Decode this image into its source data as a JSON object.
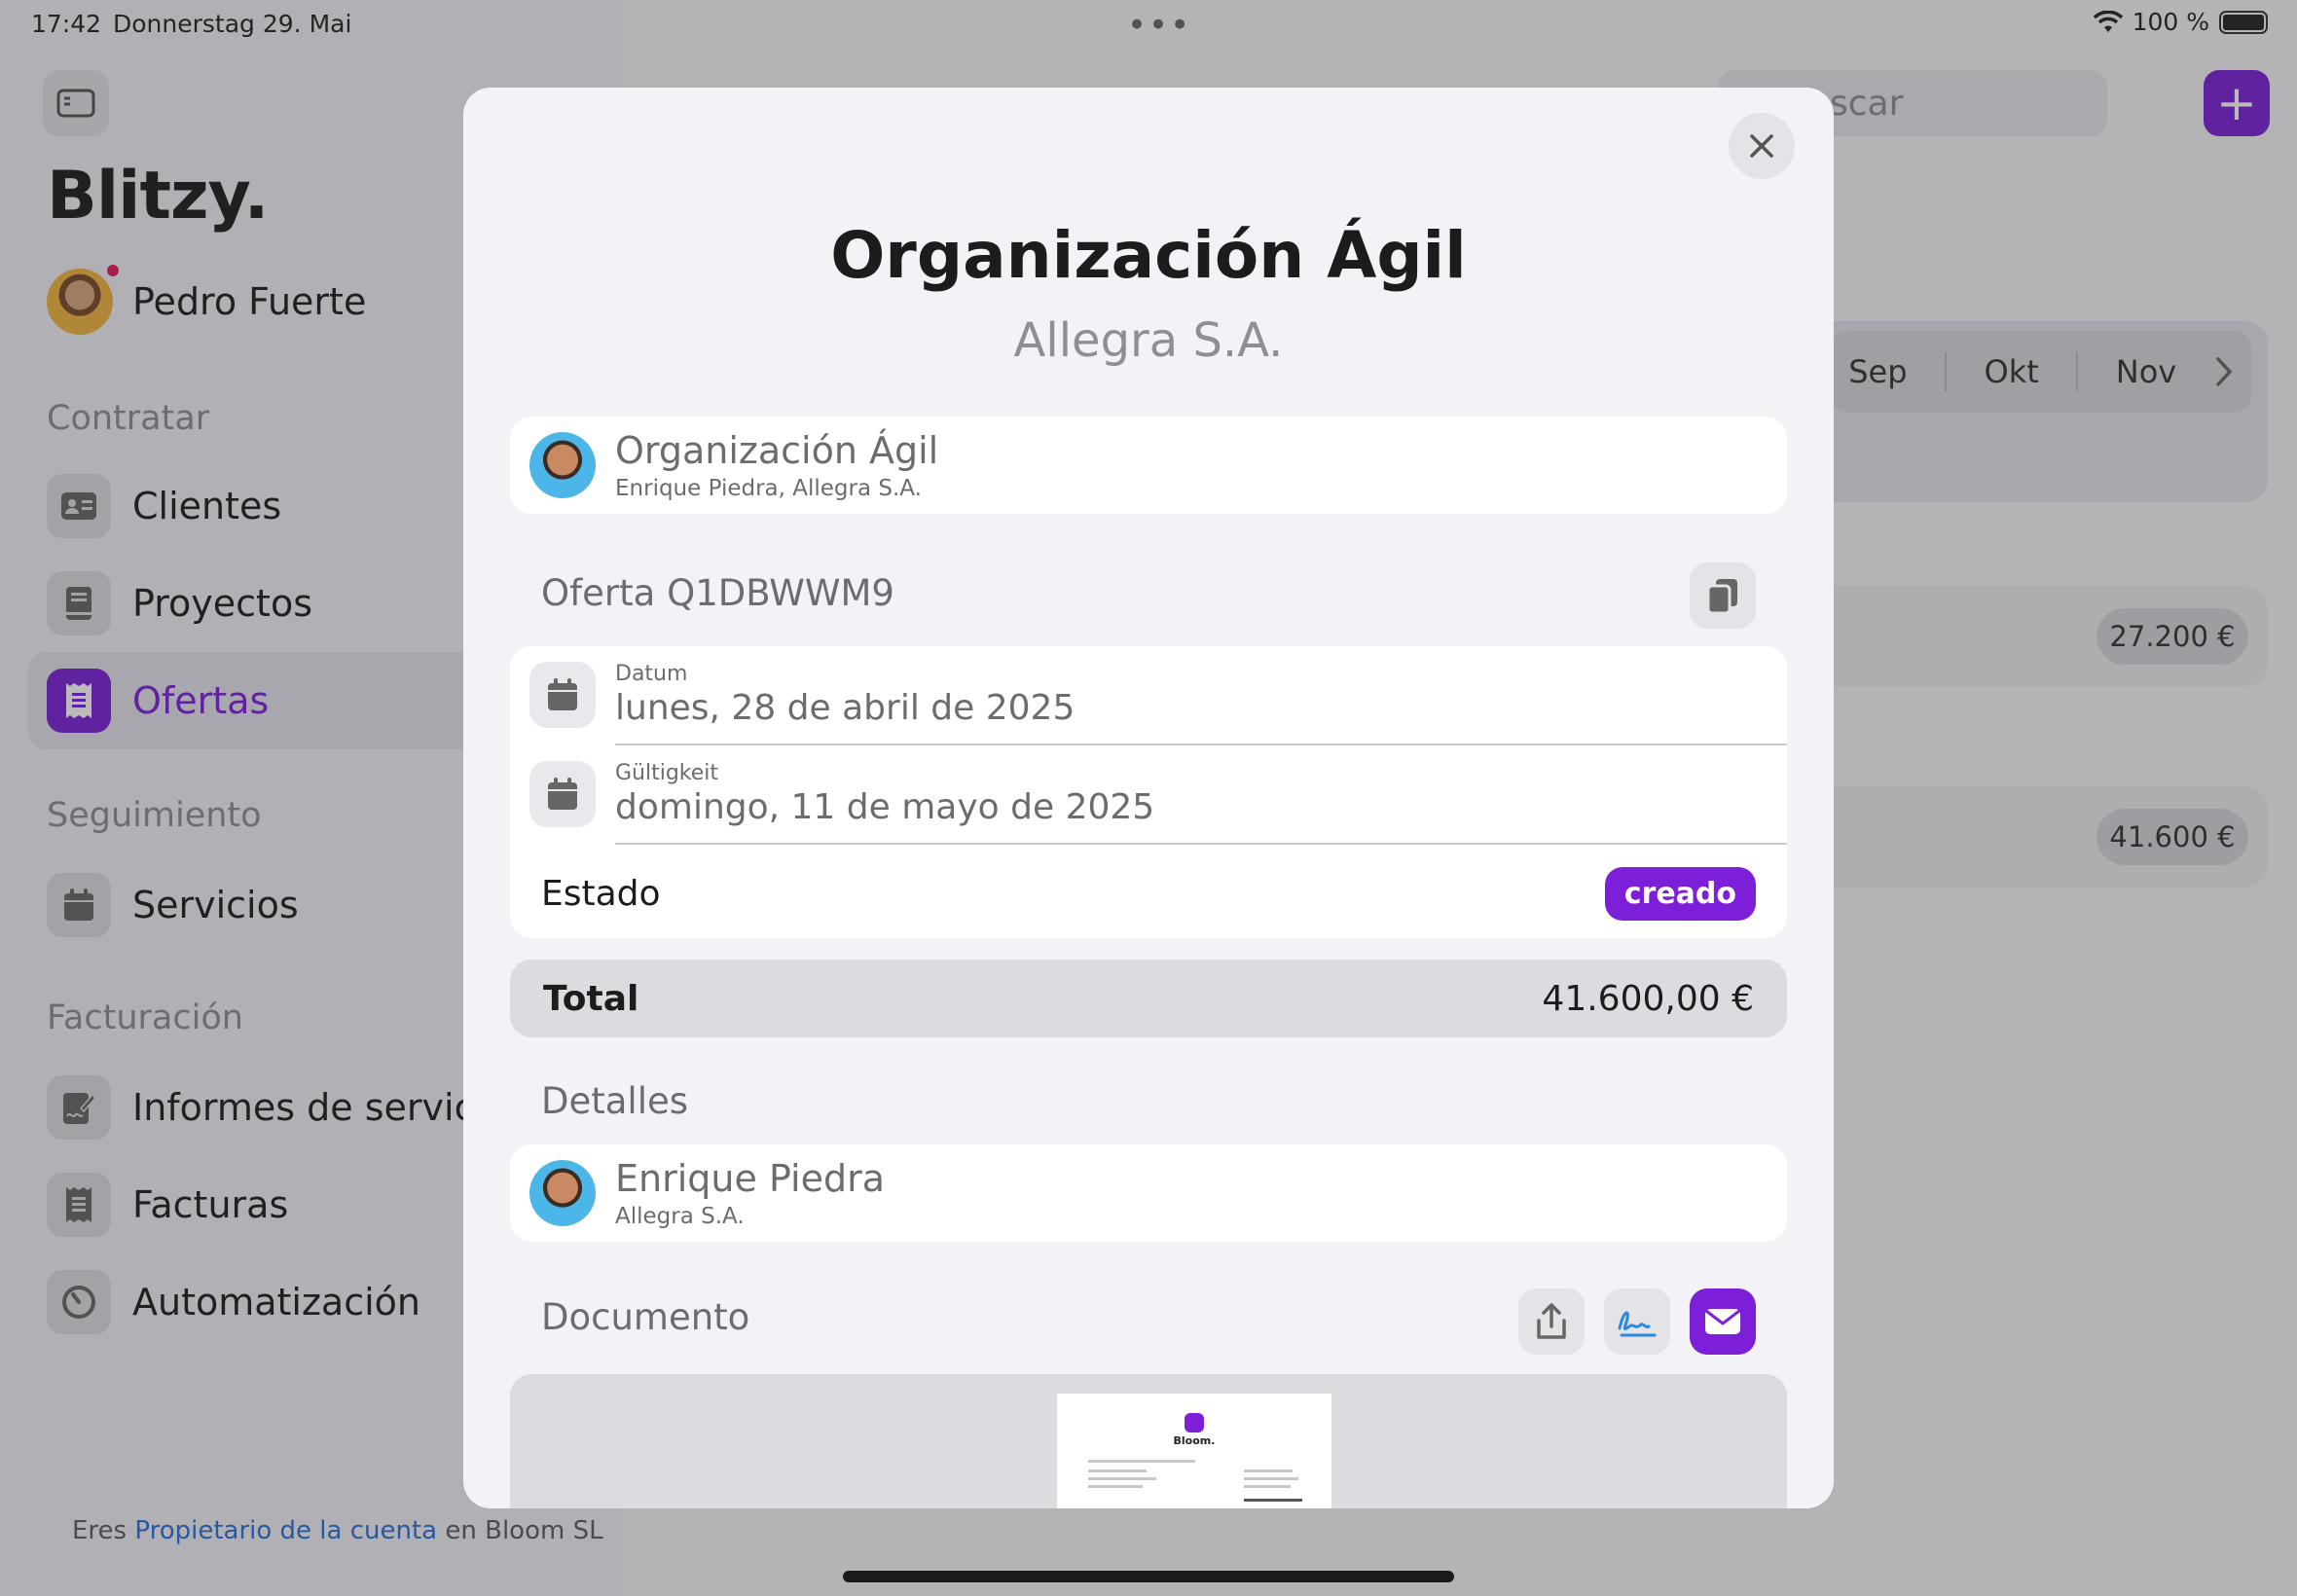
{
  "status_bar": {
    "time": "17:42",
    "date": "Donnerstag 29. Mai",
    "battery": "100 %"
  },
  "sidebar": {
    "brand": "Blitzy.",
    "user_name": "Pedro Fuerte",
    "sections": [
      {
        "title": "Contratar",
        "items": [
          {
            "label": "Clientes",
            "icon": "contact-card-icon"
          },
          {
            "label": "Proyectos",
            "icon": "book-icon"
          },
          {
            "label": "Ofertas",
            "icon": "receipt-icon",
            "active": true
          }
        ]
      },
      {
        "title": "Seguimiento",
        "items": [
          {
            "label": "Servicios",
            "icon": "calendar-icon"
          }
        ]
      },
      {
        "title": "Facturación",
        "items": [
          {
            "label": "Informes de servicio",
            "icon": "signed-document-icon"
          },
          {
            "label": "Facturas",
            "icon": "receipt-icon"
          },
          {
            "label": "Automatización",
            "icon": "timer-icon"
          }
        ]
      }
    ],
    "footer": {
      "prefix": "Eres",
      "link": "Propietario de la cuenta",
      "suffix": "en Bloom SL"
    }
  },
  "background": {
    "search_placeholder_fragment": "scar",
    "months": [
      "Sep",
      "Okt",
      "Nov"
    ],
    "amounts": [
      "27.200 €",
      "41.600 €"
    ]
  },
  "modal": {
    "title": "Organización Ágil",
    "subtitle": "Allegra S.A.",
    "project": {
      "name": "Organización Ágil",
      "detail": "Enrique Piedra, Allegra S.A."
    },
    "offer_label": "Oferta Q1DBWWM9",
    "date": {
      "label": "Datum",
      "value": "lunes, 28 de abril de 2025"
    },
    "validity": {
      "label": "Gültigkeit",
      "value": "domingo, 11 de mayo de 2025"
    },
    "status": {
      "label": "Estado",
      "value": "creado"
    },
    "total": {
      "label": "Total",
      "value": "41.600,00 €"
    },
    "details_label": "Detalles",
    "contact": {
      "name": "Enrique Piedra",
      "company": "Allegra S.A."
    },
    "document_label": "Documento",
    "document_preview": {
      "brand": "Bloom."
    }
  },
  "colors": {
    "accent": "#7d1fd8",
    "link": "#2a6fd6",
    "notification": "#e6195a"
  }
}
